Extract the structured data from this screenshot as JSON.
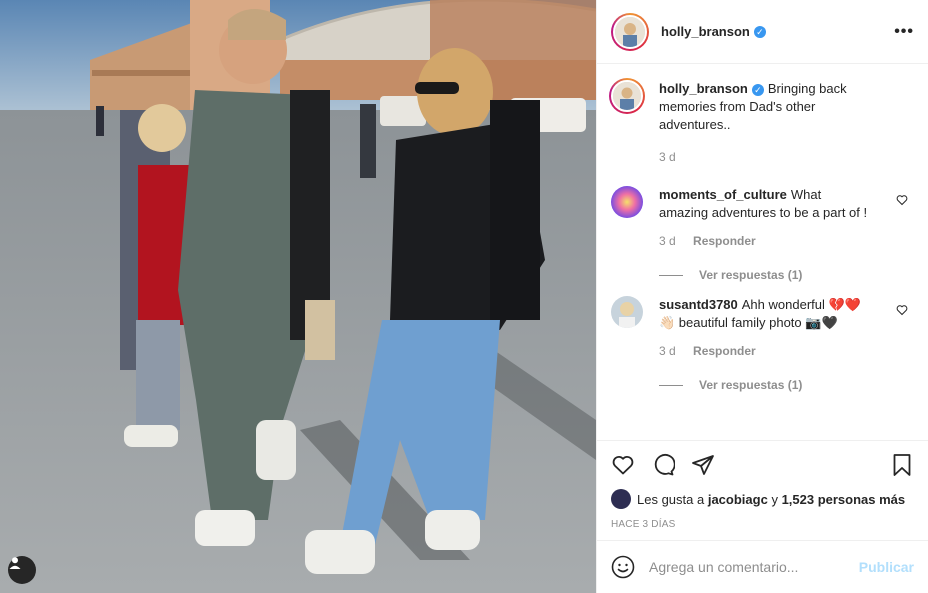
{
  "post": {
    "author": "holly_branson",
    "more_label": "•••",
    "caption": {
      "username": "holly_branson",
      "text": "Bringing back memories from Dad's other adventures..",
      "time": "3 d"
    },
    "comments": [
      {
        "username": "moments_of_culture",
        "text": "What amazing adventures to be a part of !",
        "time": "3 d",
        "reply_label": "Responder",
        "view_replies": "Ver respuestas (1)"
      },
      {
        "username": "susantd3780",
        "text": "Ahh wonderful 💔❤️ 👋🏻 beautiful family photo 📷🖤",
        "time": "3 d",
        "reply_label": "Responder",
        "view_replies": "Ver respuestas (1)"
      }
    ],
    "likes": {
      "prefix": "Les gusta a",
      "user": "jacobiagc",
      "middle": "y",
      "count": "1,523 personas más"
    },
    "date_label": "HACE 3 DÍAS",
    "add_comment_placeholder": "Agrega un comentario...",
    "publish_label": "Publicar"
  },
  "icons": [
    "user-tag-icon",
    "verified-icon",
    "more-icon",
    "heart-icon",
    "comment-icon",
    "share-icon",
    "bookmark-icon",
    "emoji-icon"
  ],
  "colors": {
    "verified": "#3897f0",
    "publish": "#b2dffc",
    "muted": "#8e8e8e",
    "text": "#262626"
  }
}
